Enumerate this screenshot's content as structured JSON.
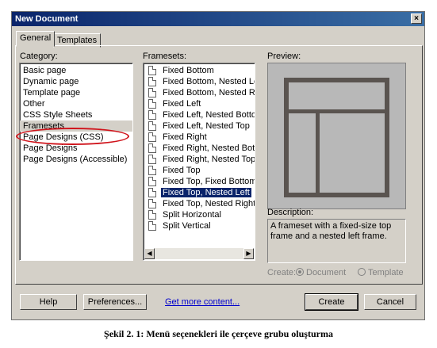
{
  "window": {
    "title": "New Document",
    "close_glyph": "×"
  },
  "tabs": [
    "General",
    "Templates"
  ],
  "category": {
    "label": "Category:",
    "items": [
      "Basic page",
      "Dynamic page",
      "Template page",
      "Other",
      "CSS Style Sheets",
      "Framesets",
      "Page Designs (CSS)",
      "Page Designs",
      "Page Designs (Accessible)"
    ],
    "selected": "Framesets"
  },
  "framesets": {
    "label": "Framesets:",
    "items": [
      "Fixed Bottom",
      "Fixed Bottom, Nested Left",
      "Fixed Bottom, Nested Righ",
      "Fixed Left",
      "Fixed Left, Nested Bottom",
      "Fixed Left, Nested Top",
      "Fixed Right",
      "Fixed Right, Nested Bottor",
      "Fixed Right, Nested Top",
      "Fixed Top",
      "Fixed Top, Fixed Bottom",
      "Fixed Top, Nested Left",
      "Fixed Top, Nested Right",
      "Split Horizontal",
      "Split Vertical"
    ],
    "selected": "Fixed Top, Nested Left"
  },
  "preview": {
    "label": "Preview:",
    "frame_color": "#5a5450",
    "bg_color": "#b8b8b8"
  },
  "description": {
    "label": "Description:",
    "text": "A frameset with a fixed-size top frame and a nested left frame."
  },
  "create_as": {
    "label": "Create:",
    "options": [
      "Document",
      "Template"
    ],
    "selected": "Document"
  },
  "buttons": {
    "help": "Help",
    "preferences": "Preferences...",
    "more_link": "Get more content...",
    "create": "Create",
    "cancel": "Cancel"
  },
  "caption": "Şekil 2. 1: Menü seçenekleri ile çerçeve grubu oluşturma",
  "colors": {
    "annotation": "#d0141c",
    "selection": "#0a246a"
  },
  "icons": {
    "frameset_item": "document-icon",
    "scroll_left": "arrow-left-icon",
    "scroll_right": "arrow-right-icon"
  }
}
